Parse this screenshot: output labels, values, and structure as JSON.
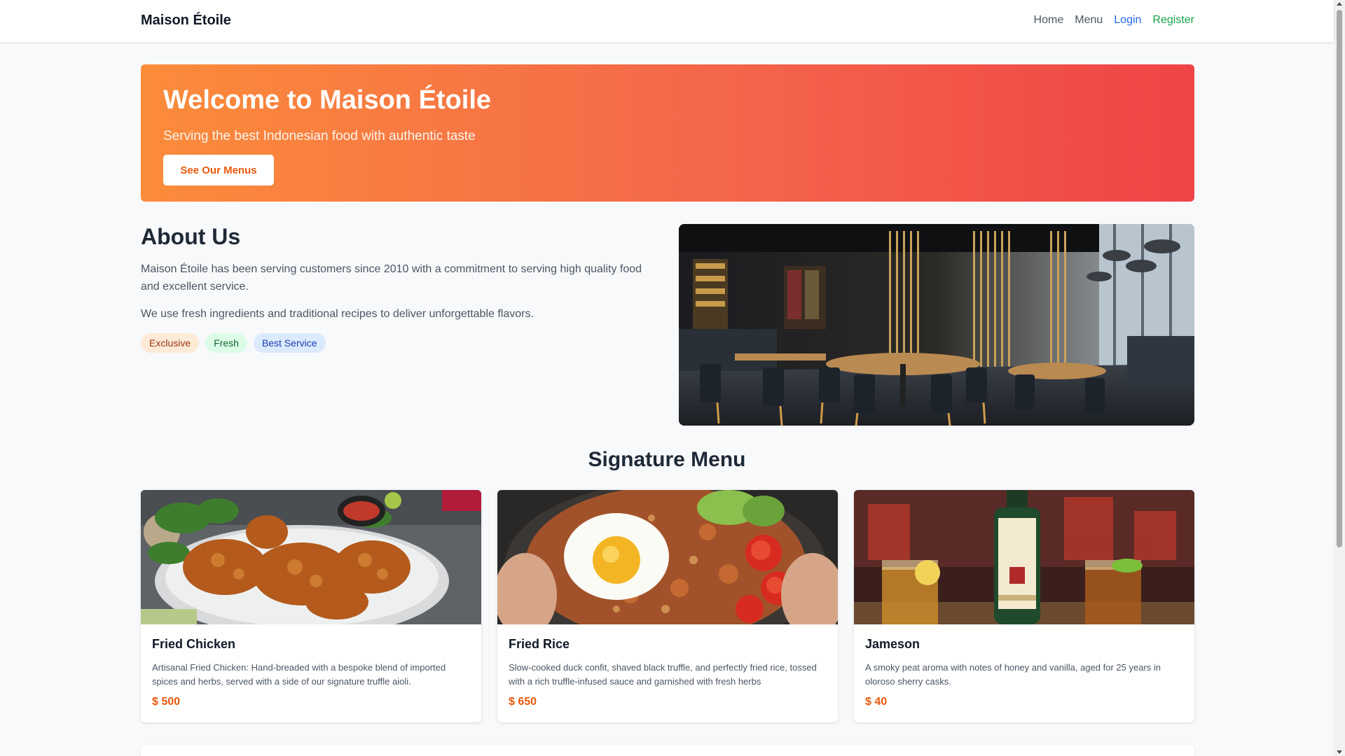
{
  "navbar": {
    "brand": "Maison Étoile",
    "links": [
      {
        "label": "Home",
        "color": "#4b5563"
      },
      {
        "label": "Menu",
        "color": "#4b5563"
      },
      {
        "label": "Login",
        "color": "#2563eb"
      },
      {
        "label": "Register",
        "color": "#16a34a"
      }
    ]
  },
  "hero": {
    "title": "Welcome to Maison Étoile",
    "subtitle": "Serving the best Indonesian food with authentic taste",
    "button_label": "See Our Menus",
    "gradient": [
      "#fb8c3a",
      "#ef4447"
    ]
  },
  "about": {
    "title": "About Us",
    "paragraph1": "Maison Étoile has been serving customers since 2010 with a commitment to serving high quality food and excellent service.",
    "paragraph2": "We use fresh ingredients and traditional recipes to deliver unforgettable flavors.",
    "tags": [
      "Exclusive",
      "Fresh",
      "Best Service"
    ]
  },
  "signature_menu": {
    "title": "Signature Menu",
    "items": [
      {
        "name": "Fried Chicken",
        "description": "Artisanal Fried Chicken: Hand-breaded with a bespoke blend of imported spices and herbs, served with a side of our signature truffle aioli.",
        "price": "$ 500"
      },
      {
        "name": "Fried Rice",
        "description": "Slow-cooked duck confit, shaved black truffle, and perfectly fried rice, tossed with a rich truffle-infused sauce and garnished with fresh herbs",
        "price": "$ 650"
      },
      {
        "name": "Jameson",
        "description": "A smoky peat aroma with notes of honey and vanilla, aged for 25 years in oloroso sherry casks.",
        "price": "$ 40"
      }
    ]
  },
  "colors": {
    "accent": "#ea580c",
    "page_background": "#f8f9fb"
  }
}
